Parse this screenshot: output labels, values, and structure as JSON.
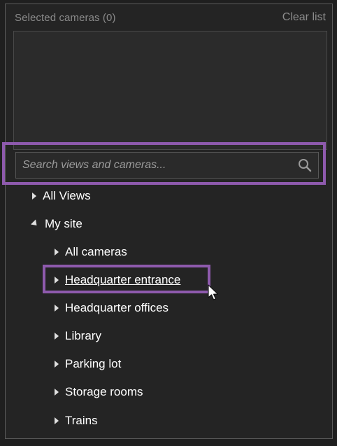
{
  "header": {
    "title": "Selected cameras (0)",
    "clear_label": "Clear list"
  },
  "search": {
    "placeholder": "Search views and cameras...",
    "value": ""
  },
  "tree": {
    "items": [
      {
        "label": "All Views",
        "expanded": false
      },
      {
        "label": "My site",
        "expanded": true
      },
      {
        "label": "All cameras",
        "expanded": false
      },
      {
        "label": "Headquarter entrance",
        "expanded": false,
        "hovered": true
      },
      {
        "label": "Headquarter offices",
        "expanded": false
      },
      {
        "label": "Library",
        "expanded": false
      },
      {
        "label": "Parking lot",
        "expanded": false
      },
      {
        "label": "Storage rooms",
        "expanded": false
      },
      {
        "label": "Trains",
        "expanded": false
      }
    ]
  },
  "colors": {
    "background": "#242424",
    "highlight": "#8e5aad",
    "text": "#ffffff",
    "muted_text": "#8a8a8a"
  },
  "icons": {
    "search": "search-icon",
    "collapsed": "caret-right-icon",
    "expanded": "caret-down-icon",
    "cursor": "mouse-pointer-icon"
  }
}
